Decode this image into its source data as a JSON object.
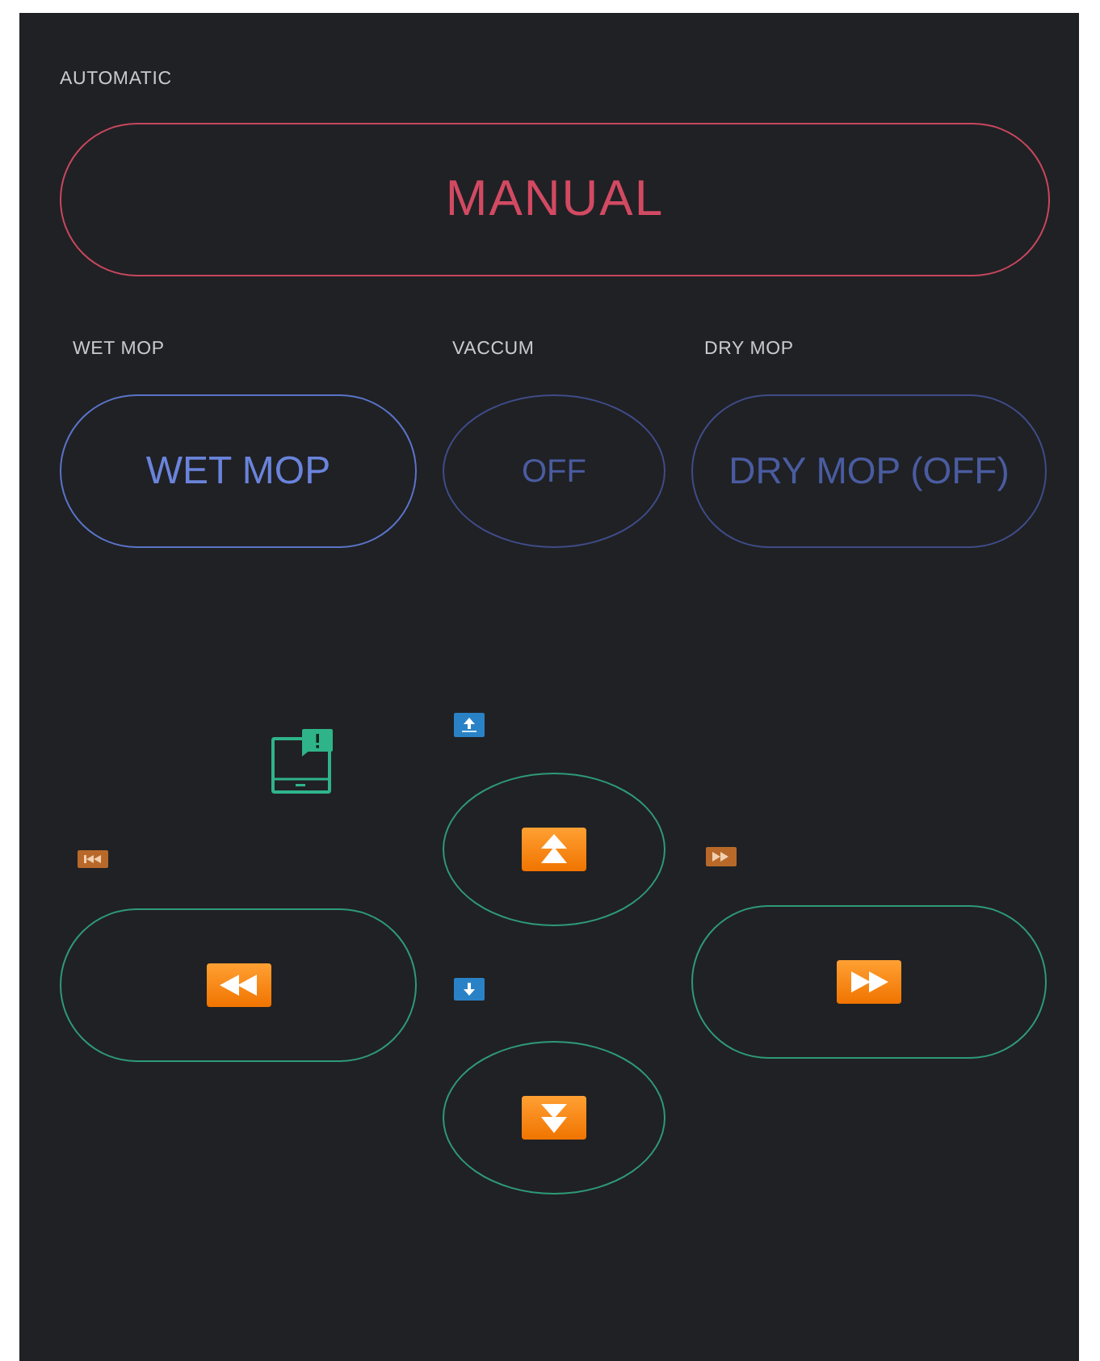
{
  "mode": {
    "label": "AUTOMATIC",
    "button": "MANUAL"
  },
  "tools": [
    {
      "label": "WET MOP",
      "button": "WET MOP",
      "on": true
    },
    {
      "label": "VACCUM",
      "button": "OFF",
      "on": false
    },
    {
      "label": "DRY MOP",
      "button": "DRY MOP (OFF)",
      "on": false
    }
  ],
  "direction_pad": [
    {
      "kind": "up"
    },
    {
      "kind": "left"
    },
    {
      "kind": "right"
    },
    {
      "kind": "down"
    }
  ]
}
